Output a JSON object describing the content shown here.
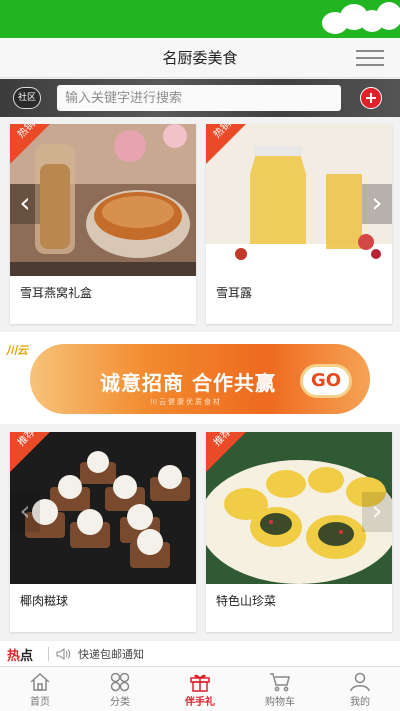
{
  "header": {
    "title": "名厨委美食"
  },
  "search": {
    "community_label": "社区",
    "placeholder": "输入关键字进行搜索"
  },
  "products": [
    {
      "name": "雪耳燕窝礼盒",
      "badge": "热销"
    },
    {
      "name": "雪耳露",
      "badge": "热销"
    },
    {
      "name": "椰肉糍球",
      "badge": "推荐"
    },
    {
      "name": "特色山珍菜",
      "badge": "推荐"
    }
  ],
  "banner": {
    "slogan": "诚意招商 合作共赢",
    "go_label": "GO",
    "sub": "川云健康优质食材",
    "logo": "川云"
  },
  "news": {
    "hot_1": "热",
    "hot_2": "点",
    "text": "快递包邮通知"
  },
  "tabs": [
    {
      "label": "首页",
      "icon": "home-icon"
    },
    {
      "label": "分类",
      "icon": "category-icon"
    },
    {
      "label": "伴手礼",
      "icon": "gift-icon",
      "active": true
    },
    {
      "label": "购物车",
      "icon": "cart-icon"
    },
    {
      "label": "我的",
      "icon": "user-icon"
    }
  ],
  "colors": {
    "status_green": "#22b522",
    "accent_red": "#e0212b",
    "badge_orange": "#ea4a28"
  }
}
